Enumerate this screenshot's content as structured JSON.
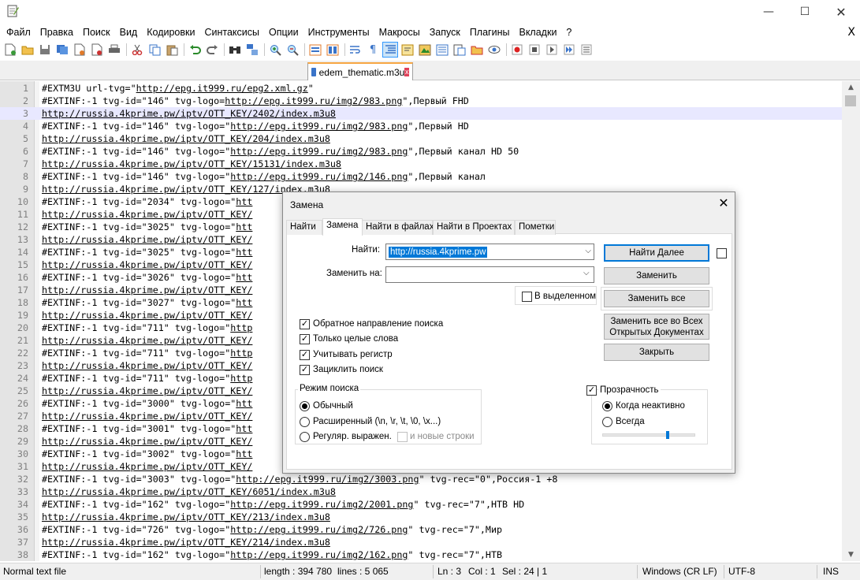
{
  "window": {
    "min_glyph": "—",
    "max_glyph": "☐",
    "close_glyph": "✕"
  },
  "menu": {
    "items": [
      "Файл",
      "Правка",
      "Поиск",
      "Вид",
      "Кодировки",
      "Синтаксисы",
      "Опции",
      "Инструменты",
      "Макросы",
      "Запуск",
      "Плагины",
      "Вкладки",
      "?"
    ],
    "close_glyph": "X"
  },
  "tab": {
    "filename": "edem_thematic.m3u",
    "close_glyph": "x"
  },
  "editor": {
    "lines": [
      {
        "n": "1",
        "pre": "#EXTM3U url-tvg=\"",
        "link": "http://epg.it999.ru/epg2.xml.gz",
        "post": "\""
      },
      {
        "n": "2",
        "pre": "#EXTINF:-1 tvg-id=\"146\" tvg-logo=",
        "link": "http://epg.it999.ru/img2/983.png",
        "post": "\",Первый FHD"
      },
      {
        "n": "3",
        "pre": "",
        "link": "http://russia.4kprime.pw/iptv/OTT_KEY/2402/index.m3u8",
        "post": ""
      },
      {
        "n": "4",
        "pre": "#EXTINF:-1 tvg-id=\"146\" tvg-logo=\"",
        "link": "http://epg.it999.ru/img2/983.png",
        "post": "\",Первый HD"
      },
      {
        "n": "5",
        "pre": "",
        "link": "http://russia.4kprime.pw/iptv/OTT_KEY/204/index.m3u8",
        "post": ""
      },
      {
        "n": "6",
        "pre": "#EXTINF:-1 tvg-id=\"146\" tvg-logo=\"",
        "link": "http://epg.it999.ru/img2/983.png",
        "post": "\",Первый канал HD 50"
      },
      {
        "n": "7",
        "pre": "",
        "link": "http://russia.4kprime.pw/iptv/OTT_KEY/15131/index.m3u8",
        "post": ""
      },
      {
        "n": "8",
        "pre": "#EXTINF:-1 tvg-id=\"146\" tvg-logo=\"",
        "link": "http://epg.it999.ru/img2/146.png",
        "post": "\",Первый канал"
      },
      {
        "n": "9",
        "pre": "",
        "link": "http://russia.4kprime.pw/iptv/OTT_KEY/127/index.m3u8",
        "post": ""
      },
      {
        "n": "10",
        "pre": "#EXTINF:-1 tvg-id=\"2034\" tvg-logo=\"",
        "link": "htt",
        "post": ""
      },
      {
        "n": "11",
        "pre": "",
        "link": "http://russia.4kprime.pw/iptv/OTT_KEY/",
        "post": ""
      },
      {
        "n": "12",
        "pre": "#EXTINF:-1 tvg-id=\"3025\" tvg-logo=\"",
        "link": "htt",
        "post": ""
      },
      {
        "n": "13",
        "pre": "",
        "link": "http://russia.4kprime.pw/iptv/OTT_KEY/",
        "post": ""
      },
      {
        "n": "14",
        "pre": "#EXTINF:-1 tvg-id=\"3025\" tvg-logo=\"",
        "link": "htt",
        "post": ""
      },
      {
        "n": "15",
        "pre": "",
        "link": "http://russia.4kprime.pw/iptv/OTT_KEY/",
        "post": ""
      },
      {
        "n": "16",
        "pre": "#EXTINF:-1 tvg-id=\"3026\" tvg-logo=\"",
        "link": "htt",
        "post": ""
      },
      {
        "n": "17",
        "pre": "",
        "link": "http://russia.4kprime.pw/iptv/OTT_KEY/",
        "post": ""
      },
      {
        "n": "18",
        "pre": "#EXTINF:-1 tvg-id=\"3027\" tvg-logo=\"",
        "link": "htt",
        "post": ""
      },
      {
        "n": "19",
        "pre": "",
        "link": "http://russia.4kprime.pw/iptv/OTT_KEY/",
        "post": ""
      },
      {
        "n": "20",
        "pre": "#EXTINF:-1 tvg-id=\"711\" tvg-logo=\"",
        "link": "http",
        "post": ""
      },
      {
        "n": "21",
        "pre": "",
        "link": "http://russia.4kprime.pw/iptv/OTT_KEY/",
        "post": ""
      },
      {
        "n": "22",
        "pre": "#EXTINF:-1 tvg-id=\"711\" tvg-logo=\"",
        "link": "http",
        "post": ""
      },
      {
        "n": "23",
        "pre": "",
        "link": "http://russia.4kprime.pw/iptv/OTT_KEY/",
        "post": ""
      },
      {
        "n": "24",
        "pre": "#EXTINF:-1 tvg-id=\"711\" tvg-logo=\"",
        "link": "http",
        "post": ""
      },
      {
        "n": "25",
        "pre": "",
        "link": "http://russia.4kprime.pw/iptv/OTT_KEY/",
        "post": ""
      },
      {
        "n": "26",
        "pre": "#EXTINF:-1 tvg-id=\"3000\" tvg-logo=\"",
        "link": "htt",
        "post": ""
      },
      {
        "n": "27",
        "pre": "",
        "link": "http://russia.4kprime.pw/iptv/OTT_KEY/",
        "post": ""
      },
      {
        "n": "28",
        "pre": "#EXTINF:-1 tvg-id=\"3001\" tvg-logo=\"",
        "link": "htt",
        "post": ""
      },
      {
        "n": "29",
        "pre": "",
        "link": "http://russia.4kprime.pw/iptv/OTT_KEY/",
        "post": ""
      },
      {
        "n": "30",
        "pre": "#EXTINF:-1 tvg-id=\"3002\" tvg-logo=\"",
        "link": "htt",
        "post": ""
      },
      {
        "n": "31",
        "pre": "",
        "link": "http://russia.4kprime.pw/iptv/OTT_KEY/",
        "post": ""
      },
      {
        "n": "32",
        "pre": "#EXTINF:-1 tvg-id=\"3003\" tvg-logo=\"",
        "link": "http://epg.it999.ru/img2/3003.png",
        "post": "\" tvg-rec=\"0\",Россия-1 +8"
      },
      {
        "n": "33",
        "pre": "",
        "link": "http://russia.4kprime.pw/iptv/OTT_KEY/6051/index.m3u8",
        "post": ""
      },
      {
        "n": "34",
        "pre": "#EXTINF:-1 tvg-id=\"162\" tvg-logo=\"",
        "link": "http://epg.it999.ru/img2/2001.png",
        "post": "\" tvg-rec=\"7\",НТВ HD"
      },
      {
        "n": "35",
        "pre": "",
        "link": "http://russia.4kprime.pw/iptv/OTT_KEY/213/index.m3u8",
        "post": ""
      },
      {
        "n": "36",
        "pre": "#EXTINF:-1 tvg-id=\"726\" tvg-logo=\"",
        "link": "http://epg.it999.ru/img2/726.png",
        "post": "\" tvg-rec=\"7\",Мир"
      },
      {
        "n": "37",
        "pre": "",
        "link": "http://russia.4kprime.pw/iptv/OTT_KEY/214/index.m3u8",
        "post": ""
      },
      {
        "n": "38",
        "pre": "#EXTINF:-1 tvg-id=\"162\" tvg-logo=\"",
        "link": "http://epg.it999.ru/img2/162.png",
        "post": "\" tvg-rec=\"7\",НТВ"
      }
    ]
  },
  "status": {
    "mode": "Normal text file",
    "length": "length : 394 780",
    "lines": "lines : 5 065",
    "ln": "Ln : 3",
    "col": "Col : 1",
    "sel": "Sel : 24 | 1",
    "eol": "Windows (CR LF)",
    "encoding": "UTF-8",
    "ins": "INS"
  },
  "dialog": {
    "title": "Замена",
    "close_glyph": "✕",
    "tabs": [
      "Найти",
      "Замена",
      "Найти в файлах",
      "Найти в Проектах",
      "Пометки"
    ],
    "find_label": "Найти:",
    "find_value": "http://russia.4kprime.pw",
    "replace_label": "Заменить на:",
    "replace_value": "",
    "in_selection": "В выделенном",
    "btn_find_next": "Найти Далее",
    "btn_replace": "Заменить",
    "btn_replace_all": "Заменить все",
    "btn_replace_all_docs_1": "Заменить все во Всех",
    "btn_replace_all_docs_2": "Открытых Документах",
    "btn_close": "Закрыть",
    "opt_backward": "Обратное направление поиска",
    "opt_whole_word": "Только целые слова",
    "opt_match_case": "Учитывать регистр",
    "opt_wrap": "Зациклить поиск",
    "mode_title": "Режим поиска",
    "mode_normal": "Обычный",
    "mode_extended": "Расширенный (\\n, \\r, \\t, \\0, \\x...)",
    "mode_regex": "Регуляр. выражен.",
    "mode_newlines": "и новые строки",
    "transparency": "Прозрачность",
    "trans_inactive": "Когда неактивно",
    "trans_always": "Всегда",
    "transparency_level": 0.7,
    "check_glyph": "✓"
  },
  "colors": {
    "accent": "#0078d7",
    "tab_accent": "#f7a642",
    "current_line": "#e8e8ff"
  }
}
